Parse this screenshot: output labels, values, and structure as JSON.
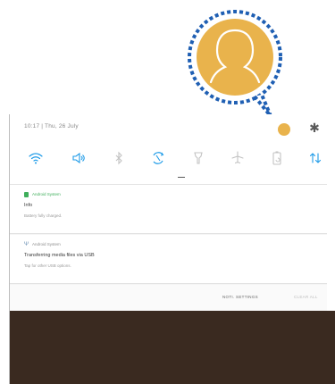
{
  "status_bar": {
    "datetime": "10:17 | Thu, 26 July"
  },
  "quick_settings": {
    "icons": [
      "wifi-icon",
      "sound-icon",
      "bluetooth-icon",
      "auto-rotate-icon",
      "flashlight-icon",
      "airplane-mode-icon",
      "power-saving-icon",
      "mobile-data-icon"
    ],
    "active_color": "#1e9be8",
    "inactive_color": "#c3c3c3"
  },
  "notifications": [
    {
      "app": "Android System",
      "title": "Info",
      "subtitle": "Battery fully charged."
    },
    {
      "app": "Android System",
      "title": "Transferring media files via USB",
      "subtitle": "Tap for other USB options."
    }
  ],
  "actions": {
    "notification_settings": "NOTI. SETTINGS",
    "clear_all": "CLEAR ALL"
  },
  "colors": {
    "avatar": "#e9b34c",
    "callout_border": "#1f5fb3",
    "home_background": "#3a2a20"
  }
}
